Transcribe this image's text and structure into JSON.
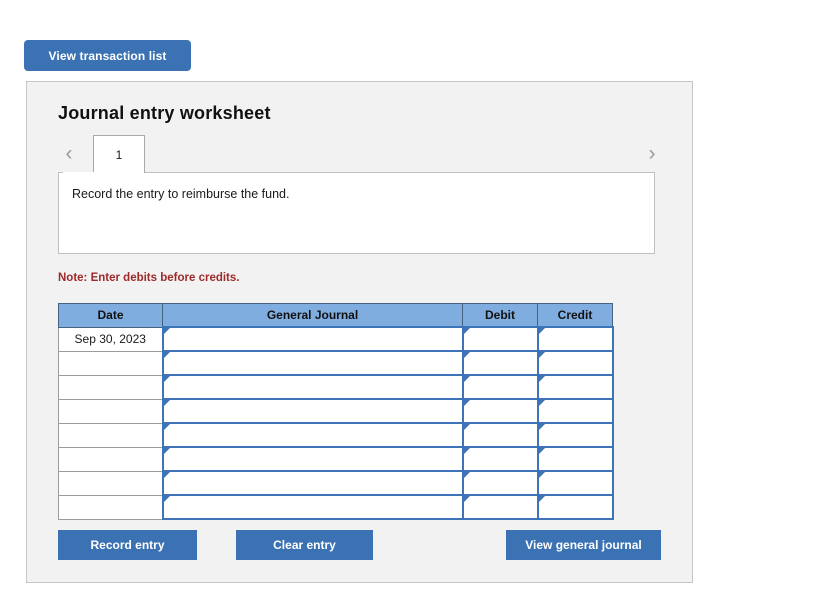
{
  "toolbar": {
    "view_transaction_list_label": "View transaction list"
  },
  "worksheet": {
    "title": "Journal entry worksheet",
    "prev_icon": "‹",
    "next_icon": "›",
    "tabs": [
      {
        "label": "1",
        "active": true
      }
    ],
    "description": "Record the entry to reimburse the fund.",
    "note": "Note: Enter debits before credits."
  },
  "table": {
    "headers": [
      "Date",
      "General Journal",
      "Debit",
      "Credit"
    ],
    "rows": [
      {
        "date": "Sep 30, 2023",
        "journal": "",
        "debit": "",
        "credit": ""
      },
      {
        "date": "",
        "journal": "",
        "debit": "",
        "credit": ""
      },
      {
        "date": "",
        "journal": "",
        "debit": "",
        "credit": ""
      },
      {
        "date": "",
        "journal": "",
        "debit": "",
        "credit": ""
      },
      {
        "date": "",
        "journal": "",
        "debit": "",
        "credit": ""
      },
      {
        "date": "",
        "journal": "",
        "debit": "",
        "credit": ""
      },
      {
        "date": "",
        "journal": "",
        "debit": "",
        "credit": ""
      },
      {
        "date": "",
        "journal": "",
        "debit": "",
        "credit": ""
      }
    ]
  },
  "actions": {
    "record_entry_label": "Record entry",
    "clear_entry_label": "Clear entry",
    "view_general_journal_label": "View general journal"
  },
  "colors": {
    "button_blue": "#3b72b4",
    "header_blue": "#7fade0",
    "cell_border_blue": "#3d74b8",
    "note_red": "#9e2a2a",
    "panel_bg": "#f2f2f2"
  }
}
